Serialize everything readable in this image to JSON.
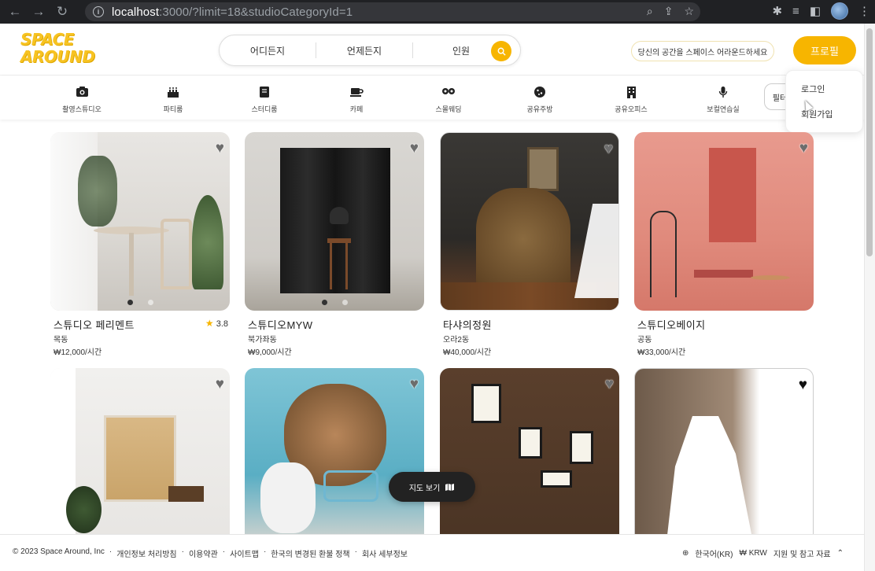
{
  "browser": {
    "url_host": "localhost",
    "url_rest": ":3000/?limit=18&studioCategoryId=1"
  },
  "header": {
    "logo_line1": "SPACE",
    "logo_line2": "AROUND",
    "search_where": "어디든지",
    "search_when": "언제든지",
    "search_guests": "인원",
    "host_link": "당신의 공간을 스페이스 어라운드하세요",
    "profile_button": "프로필"
  },
  "dropdown": {
    "login": "로그인",
    "signup": "회원가입"
  },
  "categories": [
    {
      "label": "촬영스튜디오",
      "icon": "camera-icon"
    },
    {
      "label": "파티룸",
      "icon": "cake-icon"
    },
    {
      "label": "스터디룸",
      "icon": "book-icon"
    },
    {
      "label": "카페",
      "icon": "coffee-icon"
    },
    {
      "label": "스몰웨딩",
      "icon": "wedding-icon"
    },
    {
      "label": "공유주방",
      "icon": "cookie-icon"
    },
    {
      "label": "공유오피스",
      "icon": "building-icon"
    },
    {
      "label": "보컬연습실",
      "icon": "microphone-icon"
    }
  ],
  "filter_button": "필터",
  "listings": [
    {
      "title": "스튜디오 페리멘트",
      "rating": "3.8",
      "location": "목동",
      "price": "₩12,000/시간"
    },
    {
      "title": "스튜디오MYW",
      "location": "북가좌동",
      "price": "₩9,000/시간"
    },
    {
      "title": "타샤의정원",
      "location": "오라2동",
      "price": "₩40,000/시간"
    },
    {
      "title": "스튜디오베이지",
      "location": "공동",
      "price": "₩33,000/시간"
    }
  ],
  "map_button": "지도 보기",
  "footer": {
    "copyright": "© 2023 Space Around, Inc",
    "links": [
      "개인정보 처리방침",
      "이용약관",
      "사이트맵",
      "한국의 변경된 환불 정책",
      "회사 세부정보"
    ],
    "language": "한국어(KR)",
    "currency": "₩ KRW",
    "support": "지원 및 참고 자료"
  },
  "colors": {
    "brand": "#f7b500",
    "logo": "#f7c322"
  }
}
